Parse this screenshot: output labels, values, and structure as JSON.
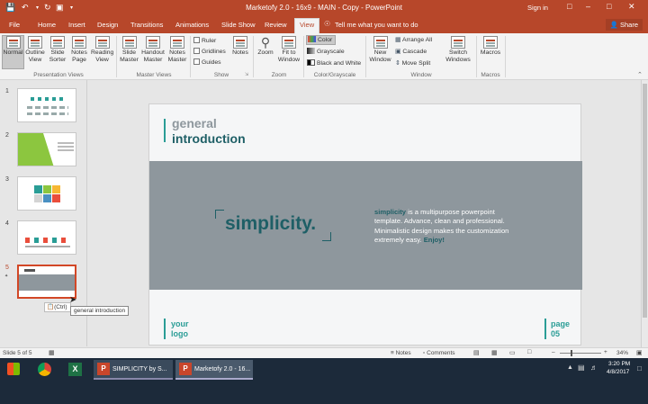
{
  "window": {
    "title": "Marketofy 2.0 - 16x9 - MAIN - Copy  -  PowerPoint",
    "sign_in": "Sign in",
    "share": "Share"
  },
  "tabs": [
    "File",
    "Home",
    "Insert",
    "Design",
    "Transitions",
    "Animations",
    "Slide Show",
    "Review",
    "View"
  ],
  "active_tab": "View",
  "tell_me": "Tell me what you want to do",
  "ribbon": {
    "presentation_views": {
      "group": "Presentation Views",
      "buttons": [
        "Normal",
        "Outline View",
        "Slide Sorter",
        "Notes Page",
        "Reading View"
      ]
    },
    "master_views": {
      "group": "Master Views",
      "buttons": [
        "Slide Master",
        "Handout Master",
        "Notes Master"
      ]
    },
    "show": {
      "group": "Show",
      "checks": [
        "Ruler",
        "Gridlines",
        "Guides"
      ],
      "notes": "Notes"
    },
    "zoom": {
      "group": "Zoom",
      "buttons": [
        "Zoom",
        "Fit to Window"
      ]
    },
    "color": {
      "group": "Color/Grayscale",
      "items": [
        "Color",
        "Grayscale",
        "Black and White"
      ]
    },
    "window": {
      "group": "Window",
      "new_window": "New Window",
      "items": [
        "Arrange All",
        "Cascade",
        "Move Split"
      ],
      "switch": "Switch Windows"
    },
    "macros": {
      "group": "Macros",
      "button": "Macros"
    }
  },
  "thumbnails": [
    "1",
    "2",
    "3",
    "4",
    "5"
  ],
  "paste_hint": "(Ctrl)",
  "tooltip": "general introduction",
  "slide": {
    "title_line1": "general",
    "title_line2": "introduction",
    "hero": "simplicity.",
    "desc_highlight": "simplicity",
    "desc_body": " is a multipurpose powerpoint template. Advance, clean and professional. Minimalistic design makes the customization extremely easy. ",
    "desc_end": "Enjoy!",
    "logo_line1": "your",
    "logo_line2": "logo",
    "page_line1": "page",
    "page_line2": "05"
  },
  "status": {
    "slide_of": "Slide 5 of 5",
    "notes": "Notes",
    "comments": "Comments",
    "zoom": "34%"
  },
  "taskbar": {
    "task1": "SIMPLICITY by S...",
    "task2": "Marketofy 2.0 - 16...",
    "time": "3:20 PM",
    "date": "4/8/2017"
  },
  "colors": {
    "accent": "#b7472a",
    "teal": "#2a9d96",
    "dark_teal": "#1e5f66",
    "band": "#8e979d"
  }
}
